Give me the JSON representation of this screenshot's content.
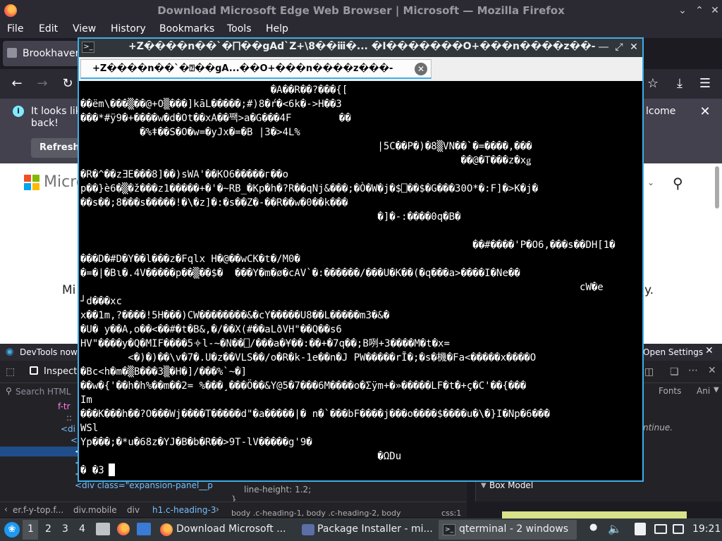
{
  "firefox": {
    "title": "Download Microsoft Edge Web Browser | Microsoft — Mozilla Firefox",
    "menu": [
      "File",
      "Edit",
      "View",
      "History",
      "Bookmarks",
      "Tools",
      "Help"
    ],
    "tab_label": "Brookhaven",
    "infobar": {
      "line1": "It looks lik",
      "line2": "back!",
      "right_text": "lcome",
      "refresh_label": "Refresh"
    },
    "content": {
      "brand_text": "Micro",
      "mid_text": "Mi",
      "right_text": "y."
    },
    "devtools": {
      "notice": "DevTools now f",
      "open_settings": "Open Settings",
      "inspector_tab": "Inspecto",
      "search_placeholder": "Search HTML",
      "fonts_tab": "Fonts",
      "anim_tab": "Ani",
      "tree_lines": [
        "f-tr",
        "::",
        "<di",
        "<",
        "<",
        "<",
        "<"
      ],
      "expansion_line": "<div class=\"expansion-panel__p",
      "css_line_height": "line-height: 1.2;",
      "css_brace": "}",
      "css_selectors": "body .c-heading-1, body .c-heading-2, body",
      "css_file": "css:1",
      "continue_text": "ntinue.",
      "box_model": "Box Model",
      "breadcrumbs": [
        "er.f-y-top.f...",
        "div.mobile",
        "div",
        "h1.c-heading-3"
      ]
    }
  },
  "qterminal": {
    "window_title": "+Z����n��`�⨅��gAd`Z+\\8��ⅲ�...  �I�������O+���n����z��-",
    "tab_title": "+Z����n��`�⍰��gA...��O+���n����z���-",
    "lines": [
      "                                �A��R��?���{[",
      "��ëm\\���▒��@+O▒���]kāL�����;#)8�ŕ�<6k�->H��3",
      "���*#ÿ9�+����w�d�Ot��xA��짹>a�G���4F        ��",
      "          �%ǂ��S�O�w=�yJx�=�B |3�>4L%",
      "                                                  |5C��P�)�8▒VN��`�=����,���",
      "                                                                ��@�T���z�xǥ",
      "�R�^��zƎE���8]��)sWA'��KO6�����г��o",
      "p��}ѐ6�▒�ž���z1�����+�'�~RB_�Kp�h�?R��qNj&���;�Ò�W�j�$⎕��$�G���30O*�:F]�>K�j�",
      "��s��;8���s�����!�\\�z]�:�s��Z�-��R��w�0��k���",
      "                                                  �]�-:����0q�B�",
      "",
      "                                                                  ��#����'P�O6,���s��DH[1�",
      "���D�#D�Y��l���z�Fqlx H�@��wCK�t�/M0�",
      "�=�|�Bɩ�.4V�����p��▒��$�  ���Y�m�ø�cAV`�:������/���U�K��(�q���a>����I�Ne��",
      "                                                                                    cW�e",
      "┘d���xc",
      "x��1m,?����!5H���)CW��������&�cY�����U8��L�����m3�&�",
      "�U� y��A,o��<��#�t�B&,�/��X(#��aLðVH\"��Q��s6",
      "HV\"����y�Q�MIF����5𐄫l-~�N��⎕/���a�¥��:��+�7q��;B咧+3����M�t�x=",
      "        <�)�)��\\v�7�.U�z��VLS��/o�R�k-1e��n�J PW�����rĨ�;�s�機�Fa<�����x����O",
      "�Bc<h�m�▒B���3▒�H�]/���%`~�]",
      "��w�{'��h�h%��m��2= %���¸���Ö��&Y@5�7���6M����o�Ʃÿm+�»�����LF�t�+ç�C'��{���",
      "Im",
      "���K���h��?O���Wj����T�����d\"�a�����|� n�`���bF����j���o����$����u�\\�}I�Np�6���",
      "WSl",
      "Yp���;�*u�68z�YJ�B�b�R��>9T-lV�����g'9�",
      "                                                  �ΩDu",
      "� �3"
    ]
  },
  "taskbar": {
    "workspaces": [
      "1",
      "2",
      "3",
      "4"
    ],
    "tasks": [
      "Download Microsoft ...",
      "Package Installer - mi...",
      "qterminal - 2 windows"
    ],
    "clock": "19:21"
  },
  "colors": {
    "accent": "#3daee9",
    "terminal_bg": "#000000",
    "terminal_fg": "#ffffff",
    "firefox_chrome": "#2b2a33"
  }
}
